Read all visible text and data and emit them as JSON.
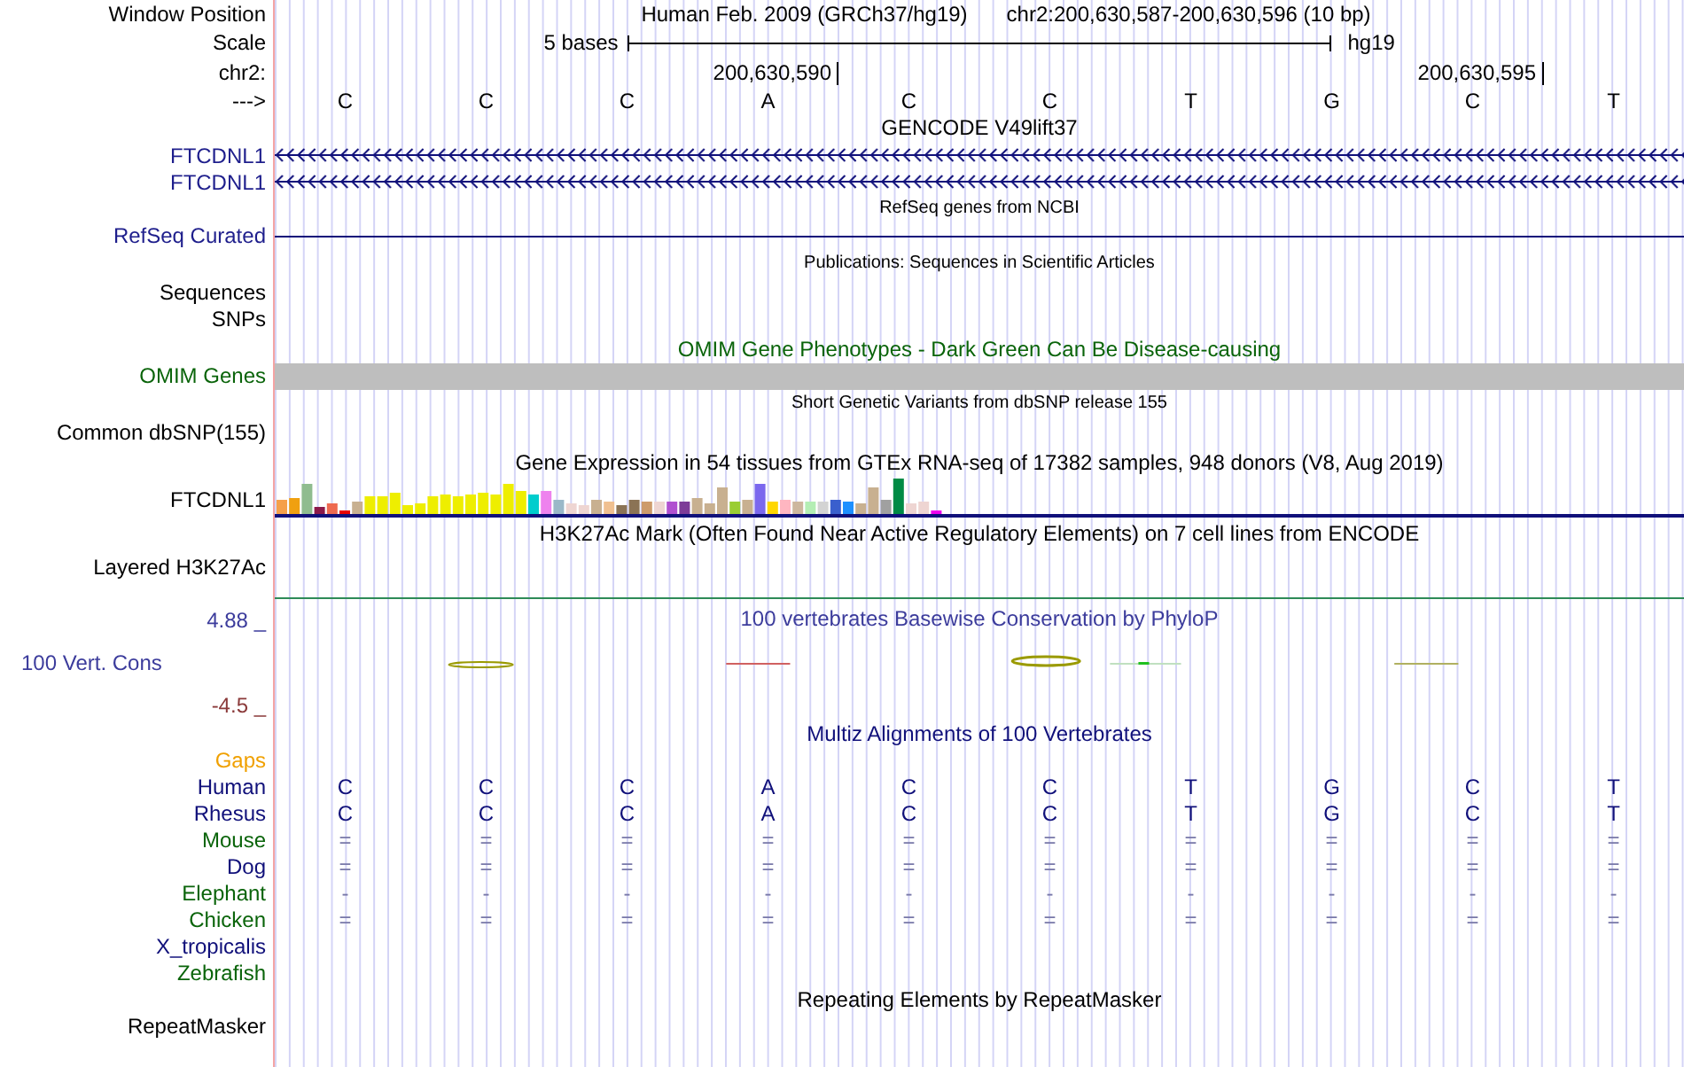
{
  "header": {
    "label": "Window Position",
    "assembly": "Human Feb. 2009 (GRCh37/hg19)",
    "position": "chr2:200,630,587-200,630,596 (10 bp)"
  },
  "scale": {
    "label": "Scale",
    "span": "5 bases",
    "assembly": "hg19"
  },
  "coordinates": {
    "label": "chr2:",
    "ticks": [
      "200,630,590",
      "200,630,595"
    ]
  },
  "sequence": {
    "label": "--->",
    "bases": [
      "C",
      "C",
      "C",
      "A",
      "C",
      "C",
      "T",
      "G",
      "C",
      "T"
    ]
  },
  "gencode": {
    "title": "GENCODE V49lift37",
    "genes": [
      "FTCDNL1",
      "FTCDNL1"
    ]
  },
  "refseq": {
    "title": "RefSeq genes from NCBI",
    "label": "RefSeq Curated"
  },
  "publications": {
    "title": "Publications: Sequences in Scientific Articles",
    "rows": [
      "Sequences",
      "SNPs"
    ]
  },
  "omim": {
    "title": "OMIM Gene Phenotypes - Dark Green Can Be Disease-causing",
    "label": "OMIM Genes"
  },
  "dbsnp": {
    "title": "Short Genetic Variants from dbSNP release 155",
    "label": "Common dbSNP(155)"
  },
  "gtex": {
    "title": "Gene Expression in 54 tissues from GTEx RNA-seq of 17382 samples, 948 donors (V8, Aug 2019)",
    "label": "FTCDNL1"
  },
  "h3k27ac": {
    "title": "H3K27Ac Mark (Often Found Near Active Regulatory Elements) on 7 cell lines from ENCODE",
    "label": "Layered H3K27Ac"
  },
  "conservation": {
    "title": "100 vertebrates Basewise Conservation by PhyloP",
    "label": "100 Vert. Cons",
    "max": "4.88 _",
    "min": "-4.5 _"
  },
  "multiz": {
    "title": "Multiz Alignments of 100 Vertebrates",
    "gaps": "Gaps",
    "species": [
      {
        "name": "Human",
        "color": "#10107a",
        "bases": [
          "C",
          "C",
          "C",
          "A",
          "C",
          "C",
          "T",
          "G",
          "C",
          "T"
        ]
      },
      {
        "name": "Rhesus",
        "color": "#10107a",
        "bases": [
          "C",
          "C",
          "C",
          "A",
          "C",
          "C",
          "T",
          "G",
          "C",
          "T"
        ]
      },
      {
        "name": "Mouse",
        "color": "#0a640a",
        "bases": [
          "=",
          "=",
          "=",
          "=",
          "=",
          "=",
          "=",
          "=",
          "=",
          "="
        ]
      },
      {
        "name": "Dog",
        "color": "#10107a",
        "bases": [
          "=",
          "=",
          "=",
          "=",
          "=",
          "=",
          "=",
          "=",
          "=",
          "="
        ]
      },
      {
        "name": "Elephant",
        "color": "#0a640a",
        "bases": [
          "-",
          "-",
          "-",
          "-",
          "-",
          "-",
          "-",
          "-",
          "-",
          "-"
        ]
      },
      {
        "name": "Chicken",
        "color": "#0a640a",
        "bases": [
          "=",
          "=",
          "=",
          "=",
          "=",
          "=",
          "=",
          "=",
          "=",
          "="
        ]
      },
      {
        "name": "X_tropicalis",
        "color": "#10107a"
      },
      {
        "name": "Zebrafish",
        "color": "#0a640a"
      }
    ]
  },
  "repeatmasker": {
    "title": "Repeating Elements by RepeatMasker",
    "label": "RepeatMasker"
  }
}
